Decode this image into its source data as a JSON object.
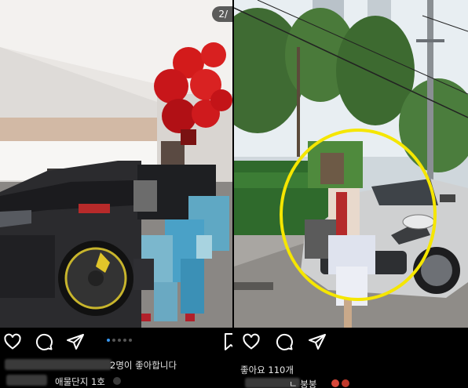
{
  "left_post": {
    "badge": "2/",
    "likes_text": "2명이 좋아합니다",
    "caption_text": "애물단지 1호",
    "carousel_dots": 5,
    "carousel_active": 1
  },
  "right_post": {
    "likes_text": "좋아요 110개",
    "caption_text": "ㄴ 붕붕"
  },
  "icons": [
    "heart-icon",
    "comment-icon",
    "share-icon",
    "bookmark-icon"
  ],
  "colors": {
    "highlight_circle": "#f5e600",
    "active_dot": "#3897f0",
    "bg": "#000000"
  }
}
